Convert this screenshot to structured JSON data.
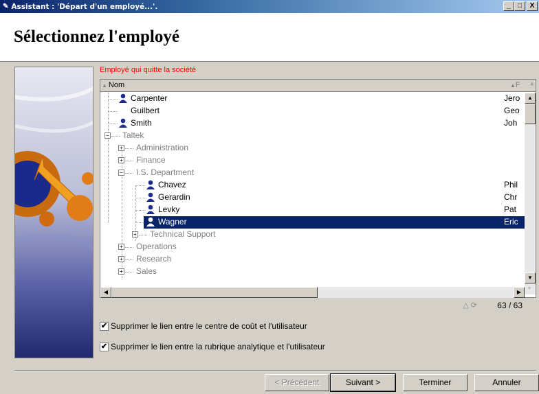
{
  "window": {
    "title": "Assistant : 'Départ d'un employé...'.",
    "controls": {
      "minimize": "_",
      "maximize": "□",
      "close": "X"
    }
  },
  "header": {
    "title": "Sélectionnez l'employé"
  },
  "tree": {
    "section_label": "Employé qui quitte la société",
    "columns": {
      "name": "Nom",
      "second": "F",
      "add": "+"
    },
    "rows": [
      {
        "label": "Carpenter",
        "col2": "Jero",
        "type": "person"
      },
      {
        "label": "Guilbert",
        "col2": "Geo",
        "type": "plain"
      },
      {
        "label": "Smith",
        "col2": "Joh",
        "type": "person"
      },
      {
        "label": "Taltek",
        "col2": "",
        "type": "group"
      },
      {
        "label": "Administration",
        "col2": "",
        "type": "group"
      },
      {
        "label": "Finance",
        "col2": "",
        "type": "group"
      },
      {
        "label": "I.S. Department",
        "col2": "",
        "type": "group"
      },
      {
        "label": "Chavez",
        "col2": "Phil",
        "type": "person"
      },
      {
        "label": "Gerardin",
        "col2": "Chr",
        "type": "person"
      },
      {
        "label": "Levky",
        "col2": "Pat",
        "type": "person"
      },
      {
        "label": "Wagner",
        "col2": "Eric",
        "type": "person",
        "selected": true
      },
      {
        "label": "Technical Support",
        "col2": "",
        "type": "group"
      },
      {
        "label": "Operations",
        "col2": "",
        "type": "group"
      },
      {
        "label": "Research",
        "col2": "",
        "type": "group"
      },
      {
        "label": "Sales",
        "col2": "",
        "type": "group"
      }
    ],
    "count": "63 / 63"
  },
  "options": [
    {
      "label": "Supprimer le lien entre le centre de coût et l'utilisateur",
      "checked": true
    },
    {
      "label": "Supprimer le lien entre la rubrique analytique et l'utilisateur",
      "checked": true
    }
  ],
  "buttons": {
    "previous": "< Précédent",
    "next": "Suivant >",
    "finish": "Terminer",
    "cancel": "Annuler"
  },
  "colors": {
    "selection": "#0a246a",
    "section_label": "#ff0000",
    "face": "#d4d0c8"
  }
}
